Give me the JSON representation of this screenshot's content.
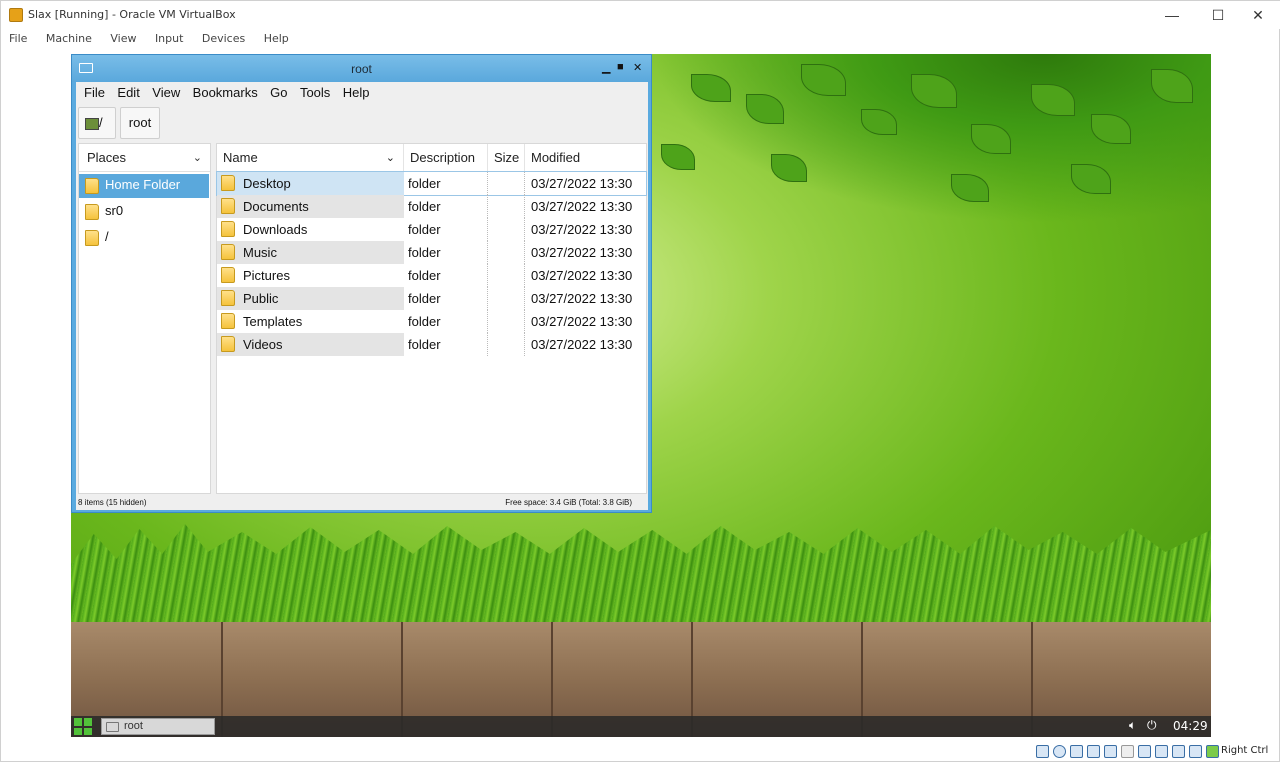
{
  "host": {
    "title": "Slax [Running] - Oracle VM VirtualBox",
    "menu": [
      "File",
      "Machine",
      "View",
      "Input",
      "Devices",
      "Help"
    ],
    "controls": {
      "minimize": "—",
      "maximize": "☐",
      "close": "✕"
    },
    "status": {
      "hostkey": "Right Ctrl"
    }
  },
  "file_manager": {
    "title": "root",
    "controls": {
      "minimize": "▁",
      "maximize": "■",
      "close": "✕"
    },
    "menu": [
      "File",
      "Edit",
      "View",
      "Bookmarks",
      "Go",
      "Tools",
      "Help"
    ],
    "path": {
      "root_label": "/",
      "current": "root"
    },
    "places": {
      "header": "Places",
      "items": [
        {
          "label": "Home Folder",
          "selected": true
        },
        {
          "label": "sr0",
          "selected": false
        },
        {
          "label": "/",
          "selected": false
        }
      ]
    },
    "columns": {
      "name": "Name",
      "description": "Description",
      "size": "Size",
      "modified": "Modified"
    },
    "rows": [
      {
        "name": "Desktop",
        "description": "folder",
        "size": "",
        "modified": "03/27/2022 13:30"
      },
      {
        "name": "Documents",
        "description": "folder",
        "size": "",
        "modified": "03/27/2022 13:30"
      },
      {
        "name": "Downloads",
        "description": "folder",
        "size": "",
        "modified": "03/27/2022 13:30"
      },
      {
        "name": "Music",
        "description": "folder",
        "size": "",
        "modified": "03/27/2022 13:30"
      },
      {
        "name": "Pictures",
        "description": "folder",
        "size": "",
        "modified": "03/27/2022 13:30"
      },
      {
        "name": "Public",
        "description": "folder",
        "size": "",
        "modified": "03/27/2022 13:30"
      },
      {
        "name": "Templates",
        "description": "folder",
        "size": "",
        "modified": "03/27/2022 13:30"
      },
      {
        "name": "Videos",
        "description": "folder",
        "size": "",
        "modified": "03/27/2022 13:30"
      }
    ],
    "status_left": "8 items (15 hidden)",
    "status_right": "Free space: 3.4 GiB (Total: 3.8 GiB)"
  },
  "taskbar": {
    "task_label": "root",
    "clock": "04:29"
  },
  "colors": {
    "accent": "#5aa8dc",
    "selection": "#cfe4f4",
    "taskbar": "#282828",
    "start": "#52c23a"
  },
  "icons": [
    "folder-icon",
    "drive-icon",
    "volume-icon",
    "power-icon",
    "start-grid-icon",
    "app-icon"
  ]
}
